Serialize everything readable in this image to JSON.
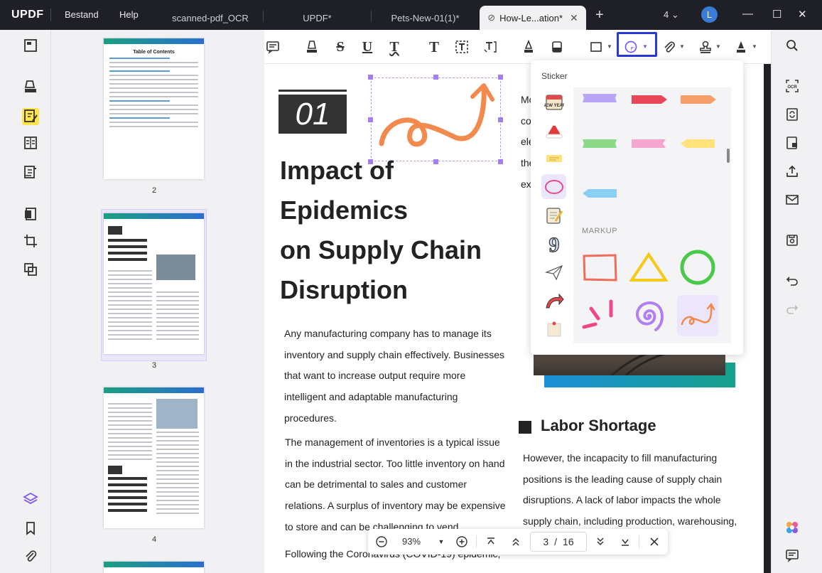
{
  "app": {
    "logo": "UPDF",
    "menus": [
      "Bestand",
      "Help"
    ],
    "tabs": [
      {
        "label": "scanned-pdf_OCR"
      },
      {
        "label": "UPDF*"
      },
      {
        "label": "Pets-New-01(1)*"
      },
      {
        "label": "How-Le...ation*"
      }
    ],
    "tab_count": "4",
    "avatar_letter": "L"
  },
  "thumbnails": {
    "pages": [
      "2",
      "3",
      "4"
    ],
    "toc_title": "Table of Contents"
  },
  "document": {
    "section_number": "01",
    "title_lines": [
      "Impact of",
      "Epidemics",
      "on Supply Chain",
      "Disruption"
    ],
    "para1_lines": [
      "Any manufacturing company has to manage its",
      "inventory and supply chain effectively. Businesses",
      "that want to increase output require more",
      "intelligent and adaptable manufacturing",
      "procedures."
    ],
    "para2_lines": [
      "The management of inventories is a typical issue",
      "in the industrial sector. Too little inventory on hand",
      "can be detrimental to sales and customer",
      "relations. A surplus of inventory may be expensive",
      "to store and can be challenging to vend."
    ],
    "para3_lines": [
      "Following the Coronavirus (COVID-19) epidemic,"
    ],
    "right_text_lines": [
      "Mo",
      "co",
      "ele",
      "the",
      "ex"
    ],
    "labor_heading": "Labor Shortage",
    "labor_lines": [
      "However, the incapacity to fill manufacturing",
      "positions is the leading cause of supply chain",
      "disruptions. A lack of labor impacts the whole",
      "supply chain, including production, warehousing,"
    ]
  },
  "sticker_panel": {
    "title": "Sticker",
    "markup_label": "MARKUP"
  },
  "navbar": {
    "zoom": "93%",
    "current_page": "3",
    "separator": "/",
    "total_pages": "16"
  },
  "colors": {
    "accent": "#a47ef0",
    "highlight": "#2a39d4",
    "sticker_orange": "#f28a4e",
    "active_tool_yellow": "#ffe44d"
  }
}
